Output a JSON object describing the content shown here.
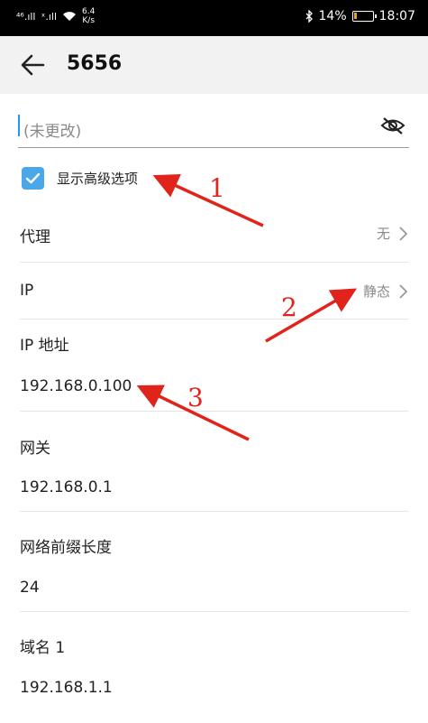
{
  "status_bar": {
    "signal_left": "⁴⁶.ıll",
    "signal_right": "ˣ.ıll",
    "net_speed_value": "6.4",
    "net_speed_unit": "K/s",
    "battery_text": "14%",
    "battery_level": 0.14,
    "time": "18:07"
  },
  "header": {
    "title": "5656"
  },
  "password_field": {
    "placeholder": "(未更改)"
  },
  "advanced_option": {
    "label": "显示高级选项",
    "checked": true
  },
  "settings": {
    "proxy": {
      "label": "代理",
      "value": "无"
    },
    "ip": {
      "label": "IP",
      "value": "静态"
    },
    "ip_address": {
      "label": "IP 地址",
      "value": "192.168.0.100"
    },
    "gateway": {
      "label": "网关",
      "value": "192.168.0.1"
    },
    "prefix_length": {
      "label": "网络前缀长度",
      "value": "24"
    },
    "dns1": {
      "label": "域名 1",
      "value": "192.168.1.1"
    }
  },
  "annotations": {
    "one": "1",
    "two": "2",
    "three": "3"
  },
  "colors": {
    "accent": "#4aa8e8",
    "annotation": "#e0241b",
    "caret": "#2196f3"
  }
}
